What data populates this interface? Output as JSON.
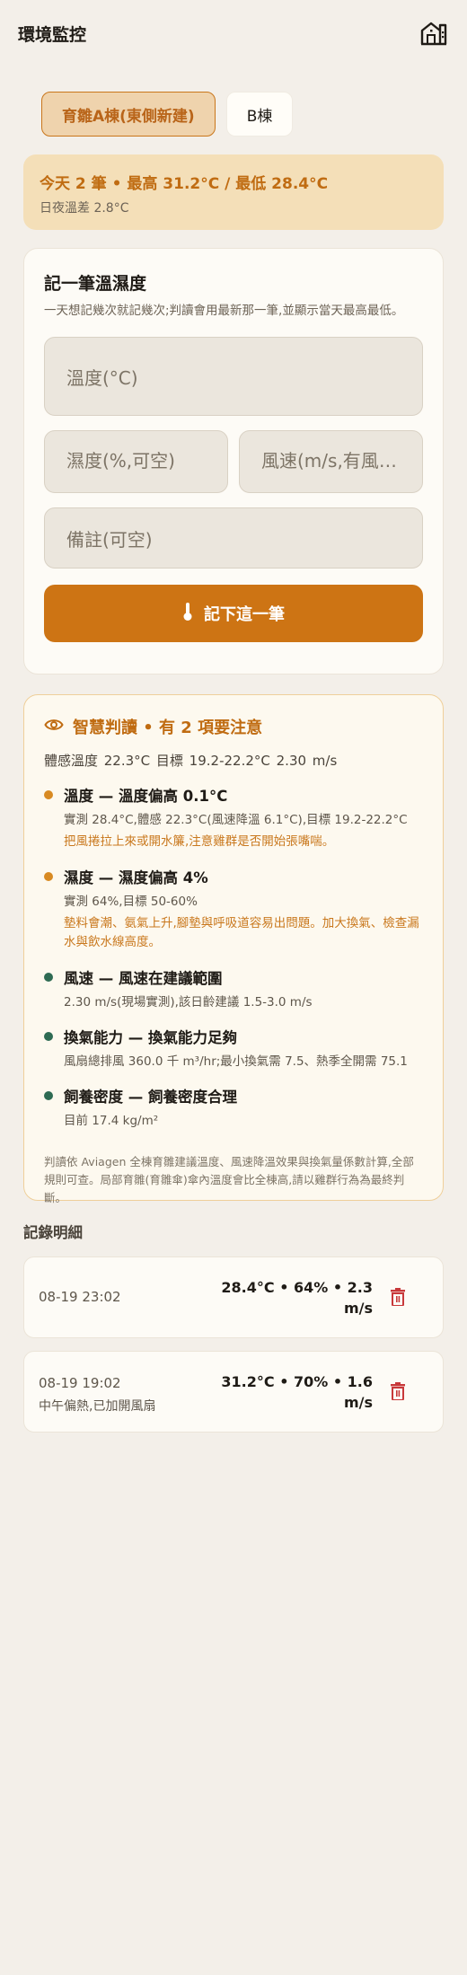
{
  "header": {
    "title": "環境監控",
    "farm_icon": "farm-building-icon"
  },
  "tabs": [
    {
      "label": "育雛A棟(東側新建)",
      "active": true
    },
    {
      "label": "B棟",
      "active": false
    }
  ],
  "summary": {
    "main": "今天 2 筆 • 最高 31.2°C / 最低 28.4°C",
    "sub": "日夜溫差 2.8°C"
  },
  "form": {
    "title": "記一筆溫濕度",
    "description": "一天想記幾次就記幾次;判讀會用最新那一筆,並顯示當天最高最低。",
    "temp_placeholder": "溫度(°C)",
    "humidity_placeholder": "濕度(%,可空)",
    "wind_placeholder": "風速(m/s,有風扇可填)",
    "note_placeholder": "備註(可空)",
    "submit_label": "記下這一筆",
    "submit_icon": "thermometer-icon"
  },
  "analysis": {
    "icon": "eye-icon",
    "title": "智慧判讀 • 有 2 項要注意",
    "metrics": "體感溫度 22.3°C   目標 19.2-22.2°C   2.30 m/s",
    "items": [
      {
        "status": "warn",
        "title": "溫度 — 溫度偏高 0.1°C",
        "detail": "實測 28.4°C,體感 22.3°C(風速降溫 6.1°C),目標 19.2-22.2°C",
        "tip": "把風捲拉上來或開水簾,注意雞群是否開始張嘴喘。"
      },
      {
        "status": "warn",
        "title": "濕度 — 濕度偏高 4%",
        "detail": "實測 64%,目標 50-60%",
        "tip": "墊料會潮、氨氣上升,腳墊與呼吸道容易出問題。加大換氣、檢查漏水與飲水線高度。"
      },
      {
        "status": "ok",
        "title": "風速 — 風速在建議範圍",
        "detail": "2.30 m/s(現場實測),該日齡建議 1.5-3.0 m/s",
        "tip": ""
      },
      {
        "status": "ok",
        "title": "換氣能力 — 換氣能力足夠",
        "detail": "風扇總排風 360.0 千 m³/hr;最小換氣需 7.5、熱季全開需 75.1",
        "tip": ""
      },
      {
        "status": "ok",
        "title": "飼養密度 — 飼養密度合理",
        "detail": "目前 17.4 kg/m²",
        "tip": ""
      }
    ],
    "note": "判讀依 Aviagen 全棟育雛建議溫度、風速降溫效果與換氣量係數計算,全部規則可查。局部育雛(育雛傘)傘內溫度會比全棟高,請以雞群行為為最終判斷。"
  },
  "records": {
    "title": "記錄明細",
    "items": [
      {
        "time": "08-19 23:02",
        "values": "28.4°C • 64% • 2.3 m/s",
        "note": ""
      },
      {
        "time": "08-19 19:02",
        "values": "31.2°C • 70% • 1.6 m/s",
        "note": "中午偏熱,已加開風扇"
      }
    ],
    "delete_icon": "trash-icon"
  },
  "colors": {
    "accent": "#cd7414",
    "warning": "#d88a22",
    "ok": "#2e6b53",
    "danger": "#c8383a",
    "background": "#f3efe9"
  }
}
